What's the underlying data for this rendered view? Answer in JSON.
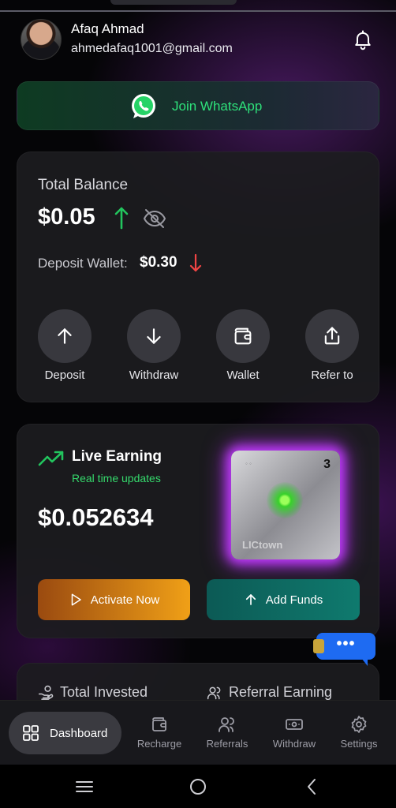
{
  "user": {
    "name": "Afaq Ahmad",
    "email": "ahmedafaq1001@gmail.com"
  },
  "whatsapp": {
    "label": "Join WhatsApp"
  },
  "balance": {
    "title": "Total Balance",
    "amount": "$0.05",
    "deposit_label": "Deposit Wallet:",
    "deposit_value": "$0.30"
  },
  "actions": [
    {
      "label": "Deposit",
      "icon": "arrow-up-icon"
    },
    {
      "label": "Withdraw",
      "icon": "arrow-down-icon"
    },
    {
      "label": "Wallet",
      "icon": "wallet-icon"
    },
    {
      "label": "Refer to",
      "icon": "share-icon"
    }
  ],
  "earning": {
    "title": "Live Earning",
    "subtitle": "Real time updates",
    "amount": "$0.052634",
    "chip_number": "3",
    "chip_brand": "LICtown",
    "activate_label": "Activate Now",
    "add_funds_label": "Add Funds"
  },
  "chat": {
    "dots": "•••"
  },
  "invest": {
    "total_invested_label": "Total Invested",
    "referral_earning_label": "Referral Earning"
  },
  "nav": {
    "active": "Dashboard",
    "items": [
      {
        "label": "Recharge",
        "icon": "recharge-icon"
      },
      {
        "label": "Referrals",
        "icon": "referrals-icon"
      },
      {
        "label": "Withdraw",
        "icon": "cash-icon"
      },
      {
        "label": "Settings",
        "icon": "gear-icon"
      }
    ]
  },
  "colors": {
    "accent_green": "#2ee07a",
    "up_arrow": "#22c55e",
    "down_arrow": "#ef4444",
    "activate_button": "#f0a017",
    "add_funds_button": "#0f7a6e",
    "chip_glow": "#c23bff",
    "chat_bubble": "#1e6bf2"
  }
}
